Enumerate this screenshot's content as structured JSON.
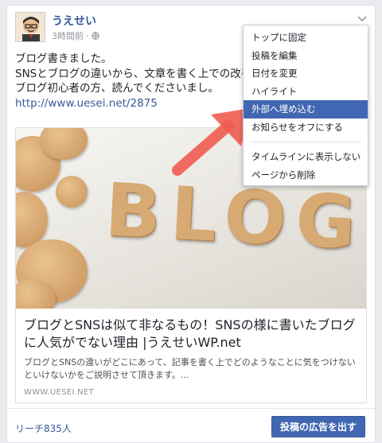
{
  "post": {
    "author": "うえせい",
    "time": "3時間前",
    "lines": [
      "ブログ書きました。",
      "SNSとブログの違いから、文章を書く上での改善",
      "ブログ初心者の方、読んでくださいまし。"
    ],
    "link": "http://www.uesei.net/2875"
  },
  "preview": {
    "image_text": "BLOG",
    "title": "ブログとSNSは似て非なるもの！SNSの様に書いたブログに人気がでない理由 |うえせいWP.net",
    "description": "ブログとSNSの違いがどこにあって、記事を書く上でどのようなことに気をつけないといけないかをご説明させて頂きます。...",
    "domain": "WWW.UESEI.NET"
  },
  "footer": {
    "reach": "リーチ835人",
    "boost_label": "投稿の広告を出す"
  },
  "menu": {
    "items": [
      "トップに固定",
      "投稿を編集",
      "日付を変更",
      "ハイライト",
      "外部へ埋め込む",
      "お知らせをオフにする",
      "タイムラインに表示しない",
      "ページから削除"
    ],
    "active_index": 4
  },
  "colors": {
    "link": "#365899",
    "accent": "#4267b2",
    "arrow": "#ef5b50"
  }
}
